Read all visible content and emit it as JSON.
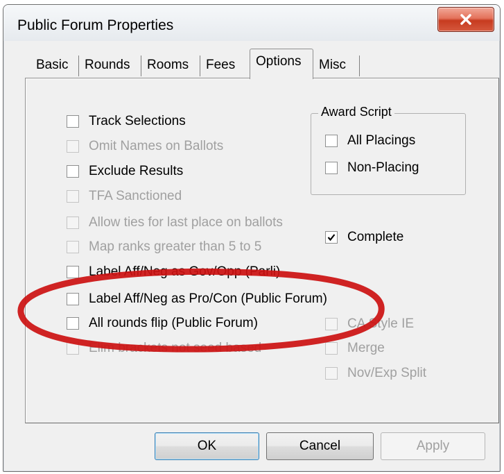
{
  "window": {
    "title": "Public Forum Properties",
    "close_icon": "close-icon"
  },
  "tabs": [
    {
      "label": "Basic",
      "active": false
    },
    {
      "label": "Rounds",
      "active": false
    },
    {
      "label": "Rooms",
      "active": false
    },
    {
      "label": "Fees",
      "active": false
    },
    {
      "label": "Options",
      "active": true
    },
    {
      "label": "Misc",
      "active": false
    }
  ],
  "options": {
    "track_selections": {
      "label": "Track Selections",
      "checked": false,
      "enabled": true
    },
    "omit_names": {
      "label": "Omit Names on Ballots",
      "checked": false,
      "enabled": false
    },
    "exclude_results": {
      "label": "Exclude Results",
      "checked": false,
      "enabled": true
    },
    "tfa_sanctioned": {
      "label": "TFA Sanctioned",
      "checked": false,
      "enabled": false
    },
    "allow_ties": {
      "label": "Allow ties for last place on ballots",
      "checked": false,
      "enabled": false
    },
    "map_ranks": {
      "label": "Map ranks greater than 5 to 5",
      "checked": false,
      "enabled": false
    },
    "label_gov_opp": {
      "label": "Label Aff/Neg as Gov/Opp (Parli)",
      "checked": false,
      "enabled": true
    },
    "label_pro_con": {
      "label": "Label Aff/Neg as Pro/Con (Public Forum)",
      "checked": false,
      "enabled": true
    },
    "all_rounds_flip": {
      "label": "All rounds flip (Public Forum)",
      "checked": false,
      "enabled": true
    },
    "elim_brackets": {
      "label": "Elim brackets not seed based",
      "checked": false,
      "enabled": false
    }
  },
  "award_script": {
    "title": "Award Script",
    "all_placings": {
      "label": "All Placings",
      "checked": false
    },
    "non_placing": {
      "label": "Non-Placing",
      "checked": false
    }
  },
  "right_options": {
    "complete": {
      "label": "Complete",
      "checked": true,
      "enabled": true
    },
    "ca_style_ie": {
      "label": "CA Style IE",
      "checked": false,
      "enabled": false
    },
    "merge": {
      "label": "Merge",
      "checked": false,
      "enabled": false
    },
    "nov_exp_split": {
      "label": "Nov/Exp Split",
      "checked": false,
      "enabled": false
    }
  },
  "buttons": {
    "ok": "OK",
    "cancel": "Cancel",
    "apply": "Apply"
  },
  "colors": {
    "highlight_ellipse": "#cc1111",
    "dialog_bg": "#f0f0f0",
    "disabled_text": "#a0a0a0"
  }
}
